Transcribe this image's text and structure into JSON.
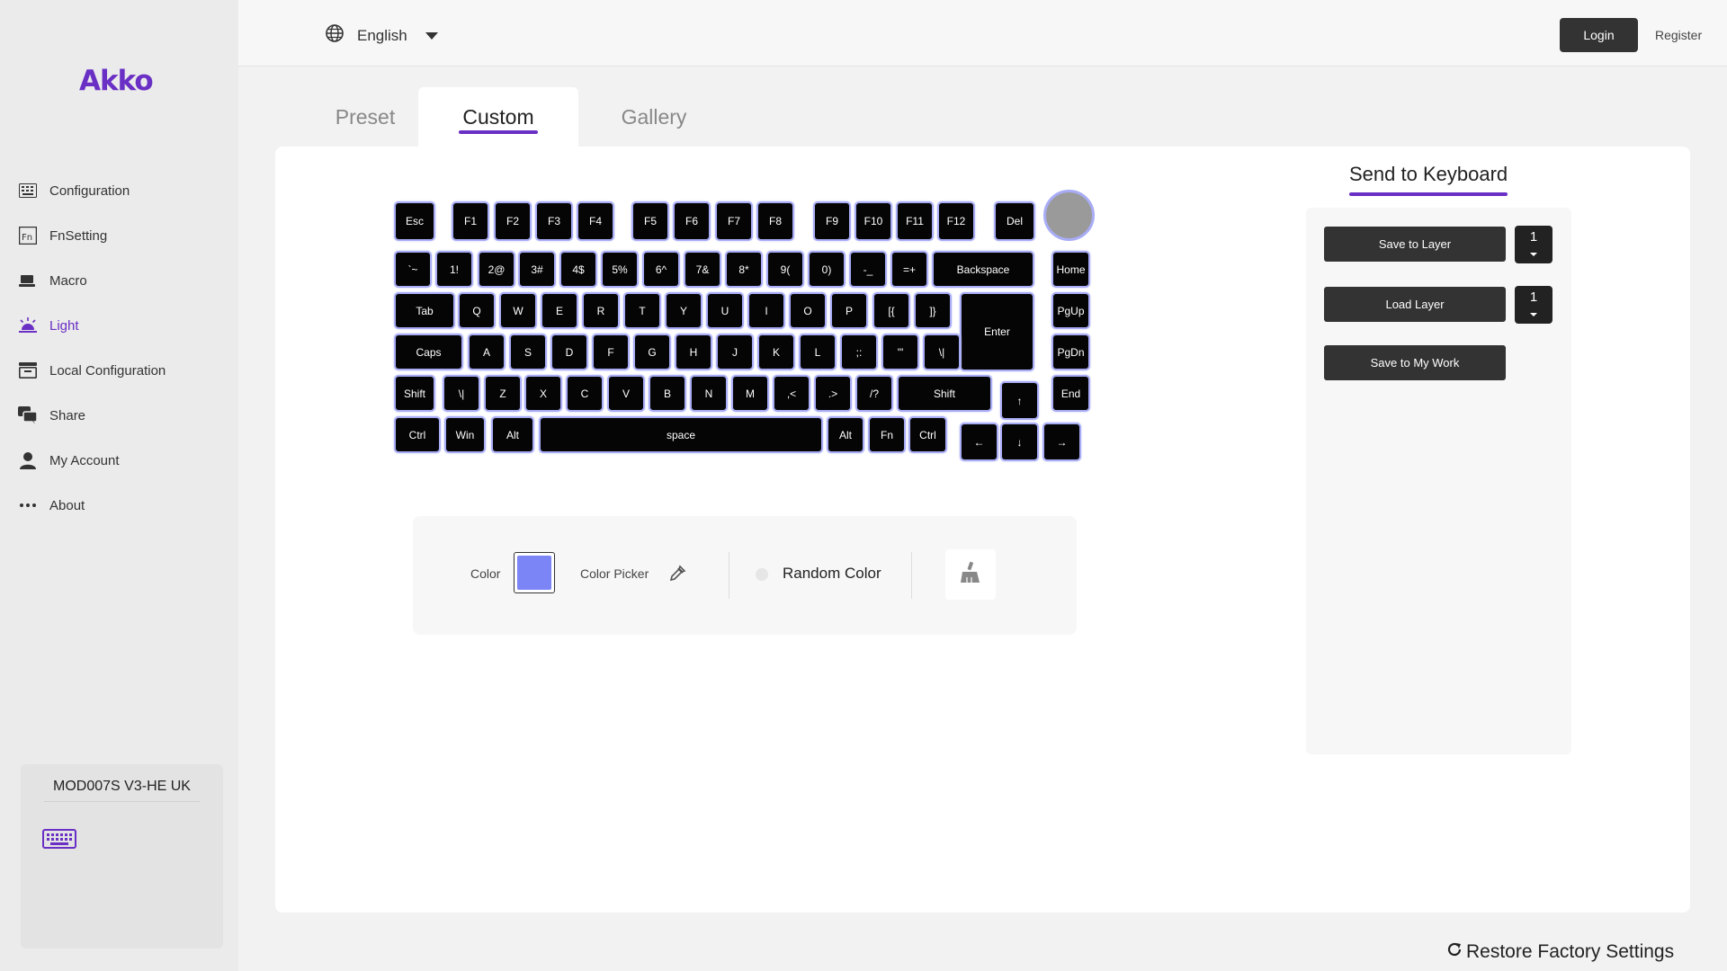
{
  "app": {
    "logo": "Akko"
  },
  "sidebar": {
    "items": [
      {
        "label": "Configuration",
        "icon": "keyboard-grid-icon",
        "active": false
      },
      {
        "label": "FnSetting",
        "icon": "fn-icon",
        "active": false
      },
      {
        "label": "Macro",
        "icon": "macro-icon",
        "active": false
      },
      {
        "label": "Light",
        "icon": "light-icon",
        "active": true
      },
      {
        "label": "Local Configuration",
        "icon": "local-config-icon",
        "active": false
      },
      {
        "label": "Share",
        "icon": "share-icon",
        "active": false
      },
      {
        "label": "My Account",
        "icon": "user-icon",
        "active": false
      },
      {
        "label": "About",
        "icon": "more-icon",
        "active": false
      }
    ],
    "device": {
      "name": "MOD007S V3-HE UK",
      "icon": "keyboard-icon"
    }
  },
  "topbar": {
    "language": "English",
    "login": "Login",
    "register": "Register"
  },
  "tabs": [
    {
      "label": "Preset",
      "active": false
    },
    {
      "label": "Custom",
      "active": true
    },
    {
      "label": "Gallery",
      "active": false
    }
  ],
  "keyboard": {
    "rows": [
      [
        "Esc",
        "F1",
        "F2",
        "F3",
        "F4",
        "F5",
        "F6",
        "F7",
        "F8",
        "F9",
        "F10",
        "F11",
        "F12",
        "Del"
      ],
      [
        "`~",
        "1!",
        "2@",
        "3#",
        "4$",
        "5%",
        "6^",
        "7&",
        "8*",
        "9(",
        "0)",
        "-_",
        "=+",
        "Backspace",
        "Home"
      ],
      [
        "Tab",
        "Q",
        "W",
        "E",
        "R",
        "T",
        "Y",
        "U",
        "I",
        "O",
        "P",
        "[{",
        "]}",
        "Enter",
        "PgUp"
      ],
      [
        "Caps",
        "A",
        "S",
        "D",
        "F",
        "G",
        "H",
        "J",
        "K",
        "L",
        ";:",
        "'\"",
        "\\|",
        "PgDn"
      ],
      [
        "Shift",
        "\\|",
        "Z",
        "X",
        "C",
        "V",
        "B",
        "N",
        "M",
        ",<",
        ".>",
        "/?",
        "Shift",
        "↑",
        "End"
      ],
      [
        "Ctrl",
        "Win",
        "Alt",
        "space",
        "Alt",
        "Fn",
        "Ctrl",
        "←",
        "↓",
        "→"
      ]
    ],
    "key_color": "#050505",
    "glow_color": "#a8acf5",
    "knob_color": "#9a9a9a"
  },
  "color_bar": {
    "color_label": "Color",
    "color_value": "#7b85f5",
    "picker_label": "Color Picker",
    "random_label": "Random Color"
  },
  "send_panel": {
    "title": "Send to Keyboard",
    "save_to_layer": "Save to Layer",
    "save_layer_value": "1",
    "load_layer": "Load Layer",
    "load_layer_value": "1",
    "save_to_work": "Save to My Work"
  },
  "footer": {
    "restore": "Restore Factory Settings"
  },
  "colors": {
    "accent": "#6a2fc4"
  }
}
